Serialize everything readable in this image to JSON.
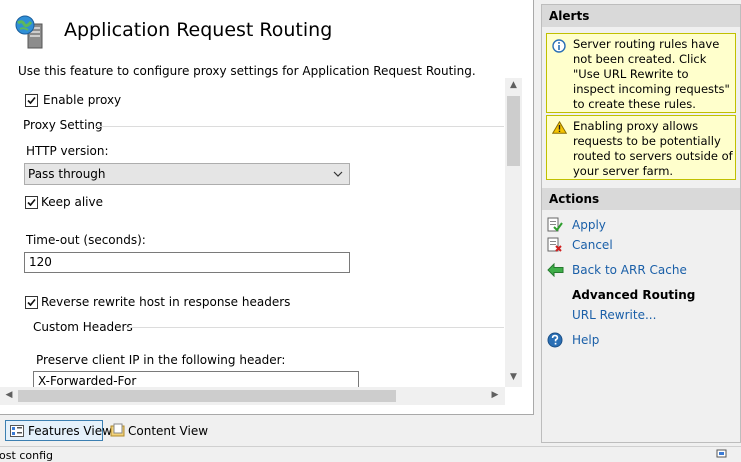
{
  "feature": {
    "title": "Application Request Routing",
    "description": "Use this feature to configure proxy settings for Application Request Routing.",
    "enable_proxy_label": "Enable proxy",
    "enable_proxy_checked": true,
    "proxy_setting_group": "Proxy Setting",
    "http_version_label": "HTTP version:",
    "http_version_value": "Pass through",
    "keep_alive_label": "Keep alive",
    "keep_alive_checked": true,
    "timeout_label": "Time-out (seconds):",
    "timeout_value": "120",
    "reverse_rewrite_label": "Reverse rewrite host in response headers",
    "reverse_rewrite_checked": true,
    "custom_headers_group": "Custom Headers",
    "preserve_ip_label": "Preserve client IP in the following header:",
    "preserve_ip_value": "X-Forwarded-For"
  },
  "views": {
    "features_view": "Features View",
    "content_view": "Content View"
  },
  "status": {
    "text": "lost config"
  },
  "alerts": {
    "header": "Alerts",
    "items": [
      {
        "icon": "info-icon",
        "text": "Server routing rules have not been created. Click \"Use URL Rewrite to inspect incoming requests\" to create these rules."
      },
      {
        "icon": "warning-icon",
        "text": "Enabling proxy allows requests to be potentially routed to servers outside of your server farm."
      }
    ]
  },
  "actions": {
    "header": "Actions",
    "apply": "Apply",
    "cancel": "Cancel",
    "back": "Back to ARR Cache",
    "advanced_routing": "Advanced Routing",
    "url_rewrite": "URL Rewrite...",
    "help": "Help"
  },
  "colors": {
    "link": "#1a5fa8",
    "alert_background": "#ffffcc",
    "pane_header": "#d9d9d9"
  }
}
